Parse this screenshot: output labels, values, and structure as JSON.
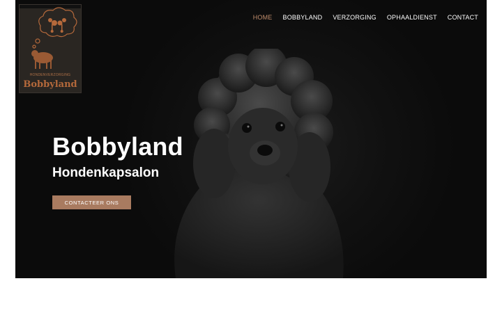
{
  "logo": {
    "small_text": "HONDENVERZORGING",
    "brand": "Bobbyland",
    "icon": "poodle-thought-bubble-icon"
  },
  "nav": {
    "items": [
      {
        "label": "HOME",
        "active": true
      },
      {
        "label": "BOBBYLAND",
        "active": false
      },
      {
        "label": "VERZORGING",
        "active": false
      },
      {
        "label": "OPHAALDIENST",
        "active": false
      },
      {
        "label": "CONTACT",
        "active": false
      }
    ]
  },
  "hero": {
    "title": "Bobbyland",
    "subtitle": "Hondenkapsalon",
    "cta_label": "CONTACTEER ONS",
    "image": "black-poodle-puppy"
  },
  "colors": {
    "accent": "#c08d6c",
    "button": "#a97b60",
    "hero_bg": "#0b0b0b"
  }
}
